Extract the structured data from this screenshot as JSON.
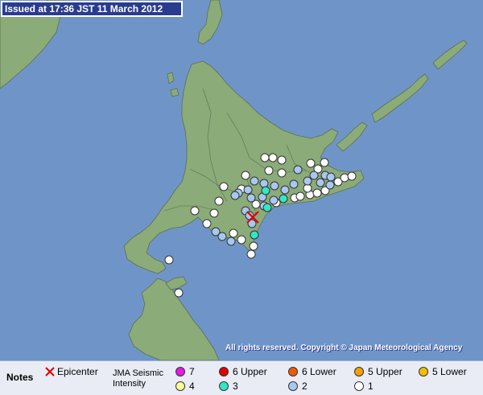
{
  "header": {
    "issued": "Issued at 17:36 JST  11 March 2012"
  },
  "map": {
    "copyright": "All rights reserved. Copyright © Japan Meteorological Agency"
  },
  "legend": {
    "notes_label": "Notes",
    "epicenter_label": "Epicenter",
    "scale_label_line1": "JMA Seismic",
    "scale_label_line2": "Intensity",
    "levels": [
      {
        "label": "7",
        "color": "#e01ee0"
      },
      {
        "label": "6 Upper",
        "color": "#e00000"
      },
      {
        "label": "6 Lower",
        "color": "#f05a00"
      },
      {
        "label": "5 Upper",
        "color": "#f5a000"
      },
      {
        "label": "5 Lower",
        "color": "#f0c000"
      },
      {
        "label": "4",
        "color": "#ffff99"
      },
      {
        "label": "3",
        "color": "#33e6c8"
      },
      {
        "label": "2",
        "color": "#a8c8f0"
      },
      {
        "label": "1",
        "color": "#ffffff"
      }
    ]
  },
  "colors": {
    "sea": "#6f95c8",
    "land": "#8bab78",
    "header_bg": "#2a3c8e",
    "epicenter": "#e00000"
  }
}
